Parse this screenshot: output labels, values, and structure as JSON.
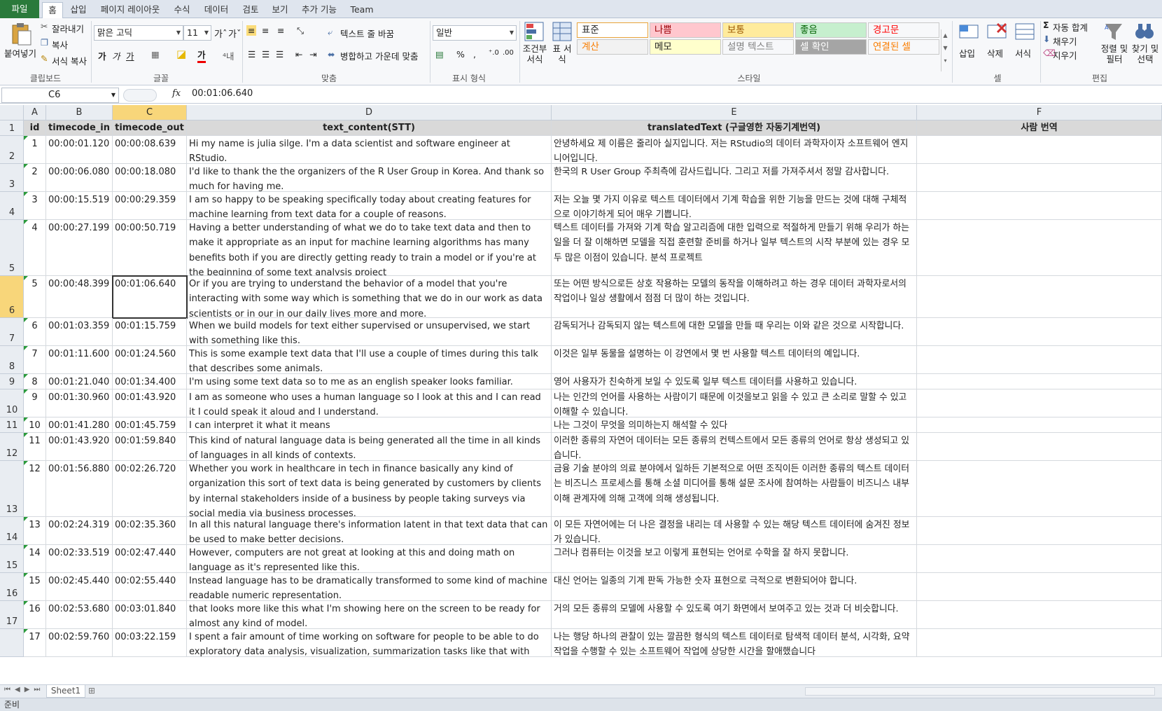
{
  "tabs": [
    "파일",
    "홈",
    "삽입",
    "페이지 레이아웃",
    "수식",
    "데이터",
    "검토",
    "보기",
    "추가 기능",
    "Team"
  ],
  "ribbon": {
    "clipboard": {
      "paste": "붙여넣기",
      "cut": "잘라내기",
      "copy": "복사",
      "format_painter": "서식 복사",
      "label": "클립보드"
    },
    "font": {
      "name": "맑은 고딕",
      "size": "11",
      "bold": "가",
      "italic": "가",
      "underline": "가",
      "label": "글꼴"
    },
    "alignment": {
      "wrap": "텍스트 줄 바꿈",
      "merge": "병합하고 가운데 맞춤",
      "label": "맞춤"
    },
    "number": {
      "format": "일반",
      "label": "표시 형식"
    },
    "styles": {
      "conditional": "조건부 서식",
      "table": "표 서식",
      "cells": [
        {
          "text": "표준",
          "bg": "#ffffff",
          "fg": "#222222"
        },
        {
          "text": "나쁨",
          "bg": "#ffc7ce",
          "fg": "#9c0006"
        },
        {
          "text": "보통",
          "bg": "#ffeb9c",
          "fg": "#9c5700"
        },
        {
          "text": "좋음",
          "bg": "#c6efce",
          "fg": "#006100"
        },
        {
          "text": "경고문",
          "bg": "#f7f8fa",
          "fg": "#ff0000"
        },
        {
          "text": "계산",
          "bg": "#f2f2f2",
          "fg": "#fa7d00"
        },
        {
          "text": "메모",
          "bg": "#ffffcc",
          "fg": "#222222"
        },
        {
          "text": "설명 텍스트",
          "bg": "#f7f8fa",
          "fg": "#7f7f7f"
        },
        {
          "text": "셀 확인",
          "bg": "#a5a5a5",
          "fg": "#ffffff"
        },
        {
          "text": "연결된 셀",
          "bg": "#f7f8fa",
          "fg": "#fa7d00"
        }
      ],
      "label": "스타일"
    },
    "cells": {
      "insert": "삽입",
      "delete": "삭제",
      "format": "서식",
      "label": "셀"
    },
    "editing": {
      "autosum": "자동 합계",
      "fill": "채우기",
      "clear": "지우기",
      "sort": "정렬 및 필터",
      "find": "찾기 및 선택",
      "label": "편집"
    }
  },
  "formula_bar": {
    "name_box": "C6",
    "fx": "fx",
    "value": "00:01:06.640"
  },
  "columns": [
    "A",
    "B",
    "C",
    "D",
    "E",
    "F"
  ],
  "header_row": [
    "id",
    "timecode_in",
    "timecode_out",
    "text_content(STT)",
    "translatedText (구글영한 자동기계번역)",
    "사람 번역"
  ],
  "rows": [
    {
      "row": "2",
      "id": "1",
      "in": "00:00:01.120",
      "out": "00:00:08.639",
      "text": "Hi my name is julia silge. I'm a data scientist and software engineer at RStudio.",
      "ko": "안녕하세요 제 이름은 줄리아 실지입니다. 저는 RStudio의 데이터 과학자이자 소프트웨어 엔지니어입니다.",
      "f": ""
    },
    {
      "row": "3",
      "id": "2",
      "in": "00:00:06.080",
      "out": "00:00:18.080",
      "text": "I'd like to thank the the organizers of the R User Group in Korea. And thank so much for having me.",
      "ko": "한국의 R User Group 주최측에 감사드립니다. 그리고 저를 가져주셔서 정말 감사합니다.",
      "f": ""
    },
    {
      "row": "4",
      "id": "3",
      "in": "00:00:15.519",
      "out": "00:00:29.359",
      "text": "I am so happy to be speaking specifically today about creating features for machine learning from text data for a couple of reasons.",
      "ko": "저는 오늘 몇 가지 이유로 텍스트 데이터에서 기계 학습을 위한 기능을 만드는 것에 대해 구체적으로 이야기하게 되어 매우 기쁩니다.",
      "f": ""
    },
    {
      "row": "5",
      "id": "4",
      "in": "00:00:27.199",
      "out": "00:00:50.719",
      "text": "Having a better understanding of what we do to take text data and then to make it appropriate as an input for machine learning algorithms has many benefits both if you are directly getting ready to train a model or if you're at the beginning of some text analysis project",
      "ko": "텍스트 데이터를 가져와 기계 학습 알고리즘에 대한 입력으로 적절하게 만들기 위해 우리가 하는 일을 더 잘 이해하면 모델을 직접 훈련할 준비를 하거나 일부 텍스트의 시작 부분에 있는 경우 모두 많은 이점이 있습니다. 분석 프로젝트",
      "f": ""
    },
    {
      "row": "6",
      "id": "5",
      "in": "00:00:48.399",
      "out": "00:01:06.640",
      "text": "Or if you are trying to understand the behavior of a model that you're interacting with some way which is something that we do in our work as data scientists or in our in our daily lives more and more.",
      "ko": "또는 어떤 방식으로든 상호 작용하는 모델의 동작을 이해하려고 하는 경우 데이터 과학자로서의 작업이나 일상 생활에서 점점 더 많이 하는 것입니다.",
      "f": ""
    },
    {
      "row": "7",
      "id": "6",
      "in": "00:01:03.359",
      "out": "00:01:15.759",
      "text": "When we build models for text either supervised or unsupervised, we start with something like this.",
      "ko": "감독되거나 감독되지 않는 텍스트에 대한 모델을 만들 때 우리는 이와 같은 것으로 시작합니다.",
      "f": ""
    },
    {
      "row": "8",
      "id": "7",
      "in": "00:01:11.600",
      "out": "00:01:24.560",
      "text": "This is some example text data that I'll use a couple of times during this talk that describes some animals.",
      "ko": "이것은 일부 동물을 설명하는 이 강연에서 몇 번 사용할 텍스트 데이터의 예입니다.",
      "f": ""
    },
    {
      "row": "9",
      "id": "8",
      "in": "00:01:21.040",
      "out": "00:01:34.400",
      "text": "I'm using some text data so to me as an english speaker looks familiar.",
      "ko": "영어 사용자가 친숙하게 보일 수 있도록 일부 텍스트 데이터를 사용하고 있습니다.",
      "f": ""
    },
    {
      "row": "10",
      "id": "9",
      "in": "00:01:30.960",
      "out": "00:01:43.920",
      "text": "I am as someone who uses a human language so I look at this and I can read it I could speak it aloud and I understand.",
      "ko": "나는 인간의 언어를 사용하는 사람이기 때문에 이것을보고 읽을 수 있고 큰 소리로 말할 수 있고 이해할 수 있습니다.",
      "f": ""
    },
    {
      "row": "11",
      "id": "10",
      "in": "00:01:41.280",
      "out": "00:01:45.759",
      "text": "I can interpret it what it means",
      "ko": "나는 그것이 무엇을 의미하는지 해석할 수 있다",
      "f": ""
    },
    {
      "row": "12",
      "id": "11",
      "in": "00:01:43.920",
      "out": "00:01:59.840",
      "text": "This kind of natural language data is being generated all the time in all kinds of languages in all kinds of contexts.",
      "ko": "이러한 종류의 자연어 데이터는 모든 종류의 컨텍스트에서 모든 종류의 언어로 항상 생성되고 있습니다.",
      "f": ""
    },
    {
      "row": "13",
      "id": "12",
      "in": "00:01:56.880",
      "out": "00:02:26.720",
      "text": "Whether you work in healthcare in tech in finance basically any kind of organization this sort of text data is being generated by customers by clients by internal stakeholders inside of a business by people taking surveys via social media via business processes.",
      "ko": "금융 기술 분야의 의료 분야에서 일하든 기본적으로 어떤 조직이든 이러한 종류의 텍스트 데이터는 비즈니스 프로세스를 통해 소셜 미디어를 통해 설문 조사에 참여하는 사람들이 비즈니스 내부 이해 관계자에 의해 고객에 의해 생성됩니다.",
      "f": ""
    },
    {
      "row": "14",
      "id": "13",
      "in": "00:02:24.319",
      "out": "00:02:35.360",
      "text": "In all this natural language there's information latent in that text data that can be used to make better decisions.",
      "ko": "이 모든 자연어에는 더 나은 결정을 내리는 데 사용할 수 있는 해당 텍스트 데이터에 숨겨진 정보가 있습니다.",
      "f": ""
    },
    {
      "row": "15",
      "id": "14",
      "in": "00:02:33.519",
      "out": "00:02:47.440",
      "text": "However, computers are not great at looking at this and doing math on language as it's represented like this.",
      "ko": "그러나 컴퓨터는 이것을 보고 이렇게 표현되는 언어로 수학을 잘 하지 못합니다.",
      "f": ""
    },
    {
      "row": "16",
      "id": "15",
      "in": "00:02:45.440",
      "out": "00:02:55.440",
      "text": "Instead language has to be dramatically transformed to some kind of machine readable numeric representation.",
      "ko": "대신 언어는 일종의 기계 판독 가능한 숫자 표현으로 극적으로 변환되어야 합니다.",
      "f": ""
    },
    {
      "row": "17",
      "id": "16",
      "in": "00:02:53.680",
      "out": "00:03:01.840",
      "text": "that looks more like this what I'm showing here on the screen to be ready for almost any kind of model.",
      "ko": "거의 모든 종류의 모델에 사용할 수 있도록 여기 화면에서 보여주고 있는 것과 더 비슷합니다.",
      "f": ""
    },
    {
      "row": "",
      "id": "17",
      "in": "00:02:59.760",
      "out": "00:03:22.159",
      "text": "I spent a fair amount of time working on software for people to be able to do exploratory data analysis, visualization, summarization tasks like that with text data",
      "ko": "나는 행당 하나의 관찰이 있는 깔끔한 형식의 텍스트 데이터로 탐색적 데이터 분석, 시각화, 요약 작업을 수행할 수 있는 소프트웨어 작업에 상당한 시간을 할애했습니다",
      "f": ""
    }
  ],
  "sheet_tab": "Sheet1",
  "status": "준비"
}
